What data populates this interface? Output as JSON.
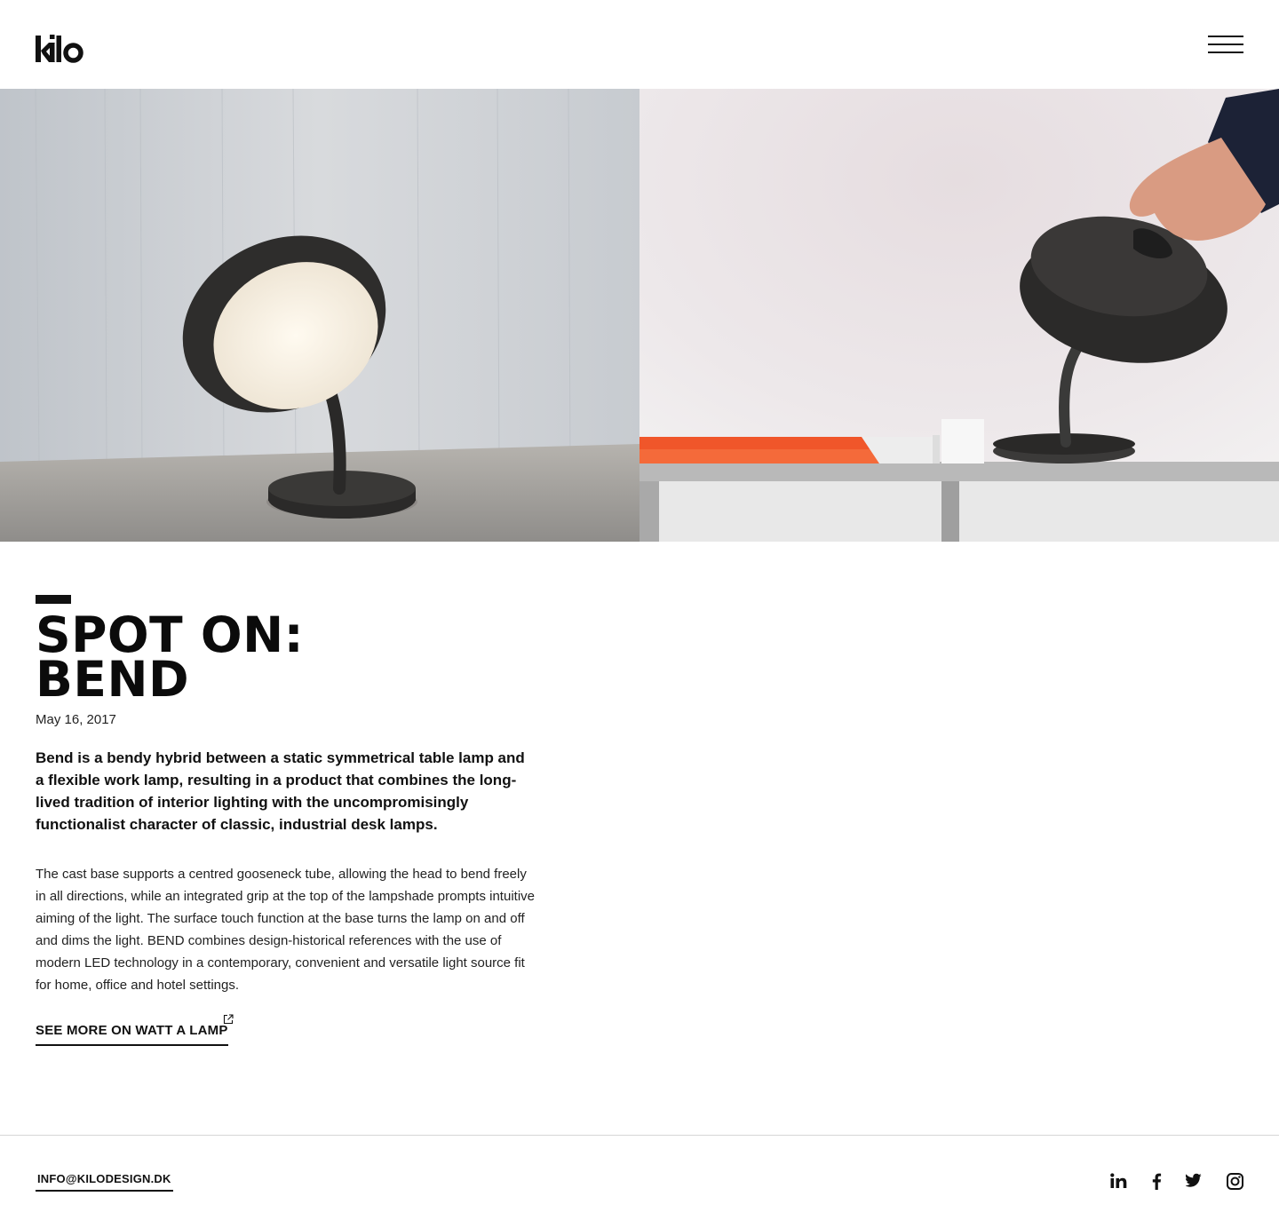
{
  "header": {
    "logo_text": "kilo",
    "menu_icon": "hamburger-menu-icon"
  },
  "hero": {
    "images": [
      {
        "name": "bend-lamp-lit-on-table",
        "icon": "photo"
      },
      {
        "name": "bend-lamp-hand-adjusting-shade",
        "icon": "photo"
      }
    ]
  },
  "article": {
    "title_line1": "SPOT ON:",
    "title_line2": "BEND",
    "date": "May 16, 2017",
    "lead": "Bend is a bendy hybrid between a static symmetrical table lamp and a flexible work lamp, resulting in a product that combines the long-lived tradition of interior lighting with the uncompromisingly functionalist character of classic, industrial desk lamps.",
    "body": "The cast base supports a centred gooseneck tube, allowing the head to bend freely in all directions, while an integrated grip at the top of the lampshade prompts intuitive aiming of the light. The surface touch function at the base turns the lamp on and off and dims the light. BEND combines design-historical references with the use of modern LED technology in a contemporary, convenient and versatile light source fit for home, office and hotel settings.",
    "cta_label": "SEE MORE ON WATT A LAMP",
    "cta_icon": "external-link-icon"
  },
  "footer": {
    "email": "INFO@KILODESIGN.DK",
    "social": [
      {
        "name": "linkedin",
        "icon": "linkedin-icon"
      },
      {
        "name": "facebook",
        "icon": "facebook-icon"
      },
      {
        "name": "twitter",
        "icon": "twitter-icon"
      },
      {
        "name": "instagram",
        "icon": "instagram-icon"
      }
    ]
  },
  "colors": {
    "text": "#111111",
    "background": "#ffffff",
    "divider": "#d6d6d6",
    "book_orange": "#f0562a"
  }
}
